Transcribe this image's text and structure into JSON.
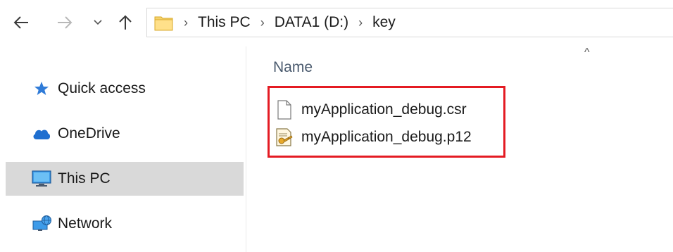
{
  "navigation": {
    "back_icon": "arrow-left-icon",
    "forward_icon": "arrow-right-icon",
    "recent_icon": "chevron-down-icon",
    "up_icon": "arrow-up-icon"
  },
  "address_bar": {
    "folder_icon": "folder-icon",
    "crumbs": [
      "This PC",
      "DATA1 (D:)",
      "key"
    ]
  },
  "sidebar": {
    "items": [
      {
        "label": "Quick access",
        "icon": "star-icon",
        "selected": false
      },
      {
        "label": "OneDrive",
        "icon": "cloud-icon",
        "selected": false
      },
      {
        "label": "This PC",
        "icon": "computer-icon",
        "selected": true
      },
      {
        "label": "Network",
        "icon": "network-icon",
        "selected": false
      }
    ]
  },
  "content": {
    "column_header": "Name",
    "sort_indicator": "^",
    "files": [
      {
        "name": "myApplication_debug.csr",
        "icon": "document-icon"
      },
      {
        "name": "myApplication_debug.p12",
        "icon": "certificate-icon"
      }
    ],
    "highlight_color": "#e41b23"
  }
}
